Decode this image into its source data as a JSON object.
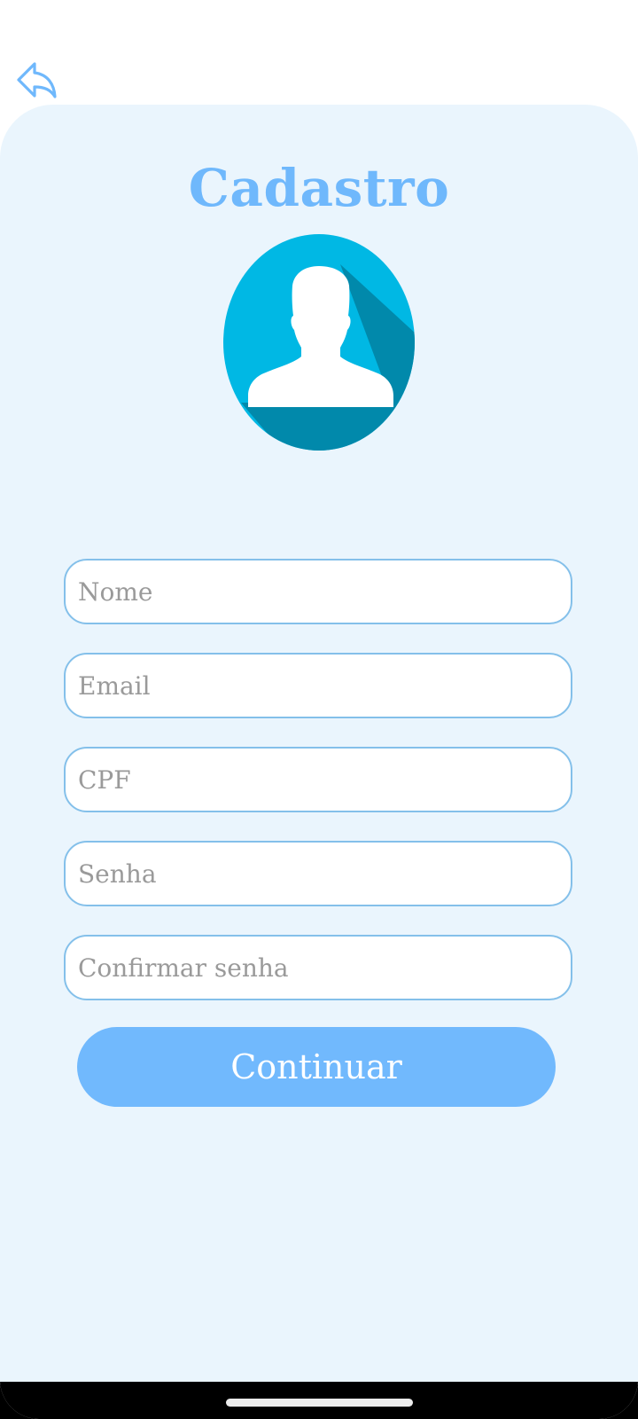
{
  "header": {
    "back_icon": "reply-arrow-icon"
  },
  "page": {
    "title": "Cadastro",
    "avatar_icon": "user-silhouette-icon"
  },
  "form": {
    "fields": [
      {
        "name": "nome",
        "placeholder": "Nome",
        "value": ""
      },
      {
        "name": "email",
        "placeholder": "Email",
        "value": ""
      },
      {
        "name": "cpf",
        "placeholder": "CPF",
        "value": ""
      },
      {
        "name": "senha",
        "placeholder": "Senha",
        "value": ""
      },
      {
        "name": "confirmar-senha",
        "placeholder": "Confirmar senha",
        "value": ""
      }
    ],
    "submit_label": "Continuar"
  },
  "colors": {
    "accent": "#6fb8fc",
    "card_background": "#eaf5fd",
    "field_border": "#84c0ea",
    "avatar_light": "#00b8e4",
    "avatar_dark": "#0189ab"
  }
}
